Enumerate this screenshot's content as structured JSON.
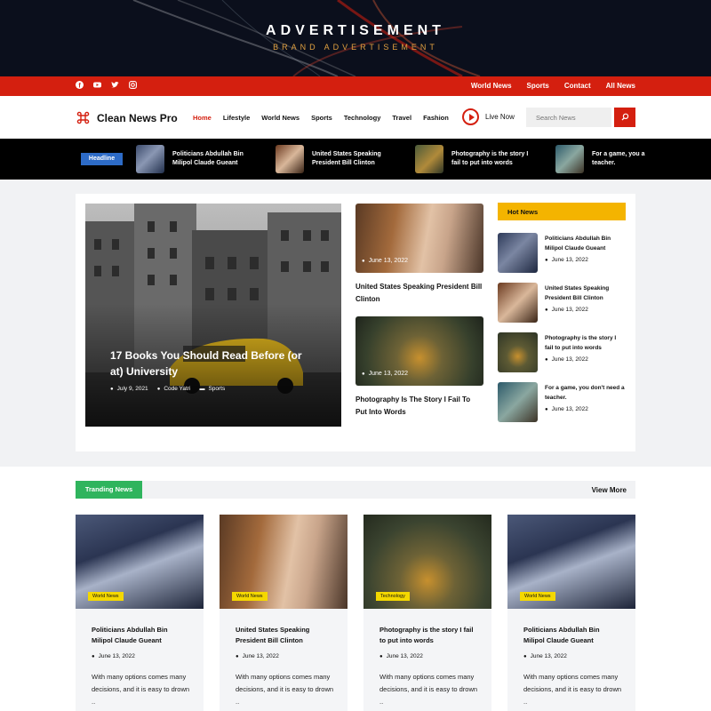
{
  "ad": {
    "title": "ADVERTISEMENT",
    "subtitle": "BRAND ADVERTISEMENT"
  },
  "topbar": {
    "social": [
      "facebook-icon",
      "youtube-icon",
      "twitter-icon",
      "instagram-icon"
    ],
    "links": [
      "World News",
      "Sports",
      "Contact",
      "All News"
    ]
  },
  "header": {
    "logo": "Clean News Pro",
    "nav": [
      "Home",
      "Lifestyle",
      "World News",
      "Sports",
      "Technology",
      "Travel",
      "Fashion"
    ],
    "live": "Live Now",
    "search_placeholder": "Search News"
  },
  "headline": {
    "badge": "Headline",
    "items": [
      "Politicians Abdullah Bin Milipol Claude Gueant",
      "United States Speaking President Bill Clinton",
      "Photography is the story I fail to put into words",
      "For a game, you a teacher."
    ]
  },
  "featured": {
    "main": {
      "title": "17 Books You Should Read Before (or at) University",
      "date": "July 9, 2021",
      "author": "Code Yatri",
      "category": "Sports"
    },
    "cards": [
      {
        "title": "United States Speaking President Bill Clinton",
        "date": "June 13, 2022"
      },
      {
        "title": "Photography Is The Story I Fail To Put Into Words",
        "date": "June 13, 2022"
      }
    ]
  },
  "hot": {
    "label": "Hot News",
    "items": [
      {
        "title": "Politicians Abdullah Bin Milipol Claude Gueant",
        "date": "June 13, 2022"
      },
      {
        "title": "United States Speaking President Bill Clinton",
        "date": "June 13, 2022"
      },
      {
        "title": "Photography is the story I fail to put into words",
        "date": "June 13, 2022"
      },
      {
        "title": "For a game, you don't need a teacher.",
        "date": "June 13, 2022"
      }
    ]
  },
  "trending": {
    "label": "Tranding News",
    "view_more": "View More",
    "cards": [
      {
        "tag": "World News",
        "title": "Politicians Abdullah Bin Milipol Claude Gueant",
        "date": "June 13, 2022",
        "desc": "With many options comes many decisions, and it is easy to drown .."
      },
      {
        "tag": "World News",
        "title": "United States Speaking President Bill Clinton",
        "date": "June 13, 2022",
        "desc": "With many options comes many decisions, and it is easy to drown .."
      },
      {
        "tag": "Technology",
        "title": "Photography is the story I fail to put into words",
        "date": "June 13, 2022",
        "desc": "With many options comes many decisions, and it is easy to drown .."
      },
      {
        "tag": "World News",
        "title": "Politicians Abdullah Bin Milipol Claude Gueant",
        "date": "June 13, 2022",
        "desc": "With many options comes many decisions, and it is easy to drown .."
      }
    ]
  },
  "colors": {
    "brand_red": "#d41f0f",
    "headline_blue": "#2d6bc7",
    "hot_yellow": "#f4b400",
    "trend_green": "#2fb45d",
    "tag_yellow": "#f4d800"
  }
}
